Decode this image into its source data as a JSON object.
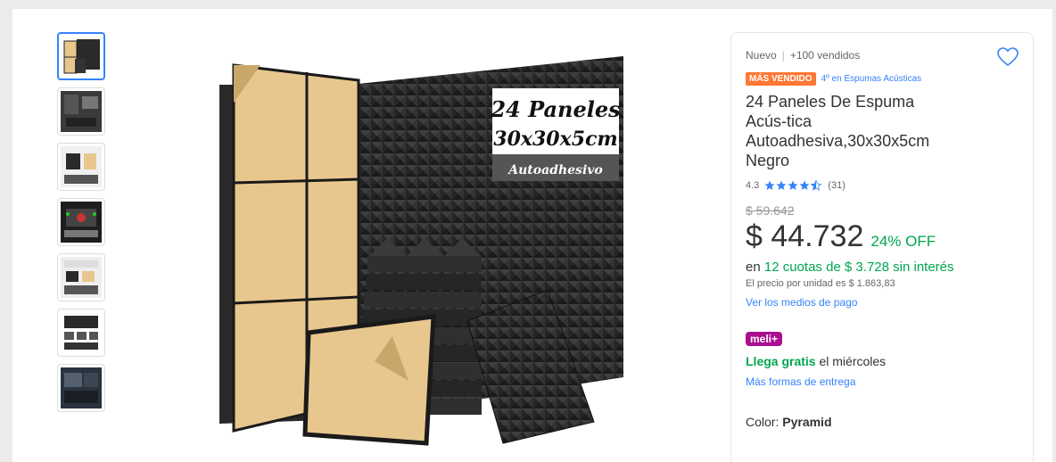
{
  "product": {
    "condition": "Nuevo",
    "sold": "+100 vendidos",
    "badge_top": "MÁS VENDIDO",
    "badge_rank": "4º en Espumas Acústicas",
    "title": "24 Paneles De Espuma Acús-tica Autoadhesiva,30x30x5cm Negro",
    "rating_value": "4.3",
    "rating_stars": 4.3,
    "rating_count": "(31)",
    "old_price": "$ 59.642",
    "price": "$ 44.732",
    "discount": "24% OFF",
    "installments_prefix": "en",
    "installments_text": "12 cuotas de $ 3.728 sin interés",
    "unit_price": "El precio por unidad es $ 1.863,83",
    "payment_link": "Ver los medios de pago",
    "meli_badge": "meli+",
    "shipping_free": "Llega gratis",
    "shipping_day": "el miércoles",
    "delivery_link": "Más formas de entrega",
    "color_label": "Color:",
    "color_value": "Pyramid"
  },
  "image_text": {
    "line1": "24 Paneles",
    "line2": "30x30x5cm",
    "line3": "Autoadhesivo"
  },
  "colors": {
    "accent": "#3483fa",
    "green": "#00a650",
    "badge_orange": "#ff7733",
    "meli_purple": "#a90f90"
  }
}
